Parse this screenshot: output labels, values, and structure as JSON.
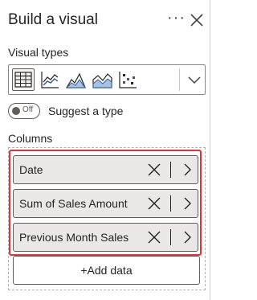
{
  "header": {
    "title": "Build a visual",
    "more_label": "···"
  },
  "visual_types": {
    "label": "Visual types",
    "icons": [
      "table-icon",
      "line-chart-icon",
      "area-chart-icon",
      "stacked-area-chart-icon",
      "scatter-chart-icon"
    ],
    "selected": "table-icon"
  },
  "suggest": {
    "toggle_text": "Off",
    "label": "Suggest a type"
  },
  "columns": {
    "label": "Columns",
    "fields": [
      {
        "label": "Date"
      },
      {
        "label": "Sum of Sales Amount"
      },
      {
        "label": "Previous Month Sales"
      }
    ],
    "add_label": "+Add data"
  },
  "colors": {
    "highlight": "#e0333a",
    "field_bg": "#e9e8e7",
    "icon_blue": "#2b579a"
  }
}
